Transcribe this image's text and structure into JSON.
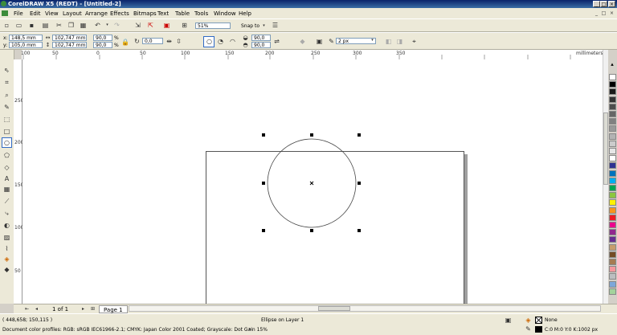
{
  "window": {
    "title": "CorelDRAW X5 (REDT) - [Untitled-2]"
  },
  "menu": [
    "File",
    "Edit",
    "View",
    "Layout",
    "Arrange",
    "Effects",
    "Bitmaps",
    "Text",
    "Table",
    "Tools",
    "Window",
    "Help"
  ],
  "standard_toolbar": {
    "zoom": "51%",
    "snap_to": "Snap to"
  },
  "property_bar": {
    "x": "148,5 mm",
    "y": "105,0 mm",
    "width": "102,747 mm",
    "height": "102,747 mm",
    "scale_x": "90,0",
    "scale_y": "90,0",
    "scale_unit": "%",
    "rotation": "0,0",
    "start_angle": "90,0",
    "end_angle": "90,0",
    "outline_width": "2 px"
  },
  "ruler": {
    "units": "millimeters",
    "h_ticks": [
      "100",
      "50",
      "0",
      "50",
      "100",
      "150",
      "200",
      "250",
      "300",
      "350"
    ],
    "v_ticks": [
      "250",
      "200",
      "150",
      "100",
      "50"
    ]
  },
  "page_nav": {
    "counter": "1 of 1",
    "page_tab": "Page 1"
  },
  "status": {
    "coords": "( 448,658; 150,115 )",
    "object_info": "Ellipse on Layer 1",
    "color_profiles": "Document color profiles: RGB: sRGB IEC61966-2.1; CMYK: Japan Color 2001 Coated; Grayscale: Dot Gain 15%",
    "fill": "None",
    "outline": "C:0 M:0 Y:0 K:100",
    "outline_width": "2 px"
  },
  "palette": [
    "#ffffff",
    "#000000",
    "#1a1a1a",
    "#333333",
    "#4d4d4d",
    "#666666",
    "#808080",
    "#999999",
    "#b3b3b3",
    "#cccccc",
    "#e6e6e6",
    "#ffffff",
    "#2e3192",
    "#0072bc",
    "#00aeef",
    "#00a651",
    "#8dc63f",
    "#fff200",
    "#f7941d",
    "#ed1c24",
    "#ec008c",
    "#92278f",
    "#662d91",
    "#c69c6d",
    "#754c24",
    "#a67c52",
    "#f5989d",
    "#bcbec0",
    "#7da7d9",
    "#a3d39c"
  ]
}
